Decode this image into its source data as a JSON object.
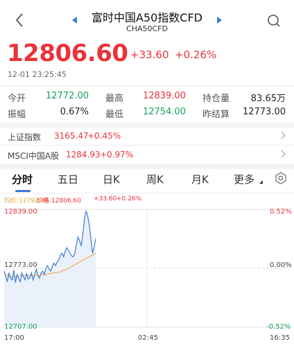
{
  "header": {
    "title": "富时中国A50指数CFD",
    "subtitle": "CHA50CFD"
  },
  "quote": {
    "price": "12806.60",
    "change": "+33.60",
    "change_pct": "+0.26%",
    "timestamp": "12-01 23:25:45"
  },
  "stats": {
    "open_label": "今开",
    "open": "12772.00",
    "high_label": "最高",
    "high": "12839.00",
    "oi_label": "持仓量",
    "oi": "83.65万",
    "amp_label": "振幅",
    "amp": "0.67%",
    "low_label": "最低",
    "low": "12754.00",
    "prev_label": "昨结算",
    "prev": "12773.00"
  },
  "indices": [
    {
      "name": "上证指数",
      "value": "3165.47",
      "pct": "+0.45%"
    },
    {
      "name": "MSCI中国A股",
      "value": "1284.93",
      "pct": "+0.97%"
    }
  ],
  "tabs": [
    "分时",
    "五日",
    "日K",
    "周K",
    "月K",
    "更多"
  ],
  "legend": {
    "avg": "均价:12792.48",
    "price": "价格:12806.60",
    "chg": "+33.60",
    "pct": "+0.26%"
  },
  "colors": {
    "up": "#e8333b",
    "down": "#17a35a",
    "line": "#3a7bd5",
    "avg": "#e8a033",
    "fill": "#eaf1fb"
  },
  "chart_data": {
    "type": "line",
    "y_left": {
      "top": "12839.00",
      "mid": "12773.00",
      "bottom": "12707.00"
    },
    "y_right": {
      "top": "0.52%",
      "mid": "0.00%",
      "bottom": "-0.52%"
    },
    "x_labels": [
      "17:00",
      "02:45",
      "16:35"
    ],
    "ylim": [
      12707,
      12839
    ],
    "prev_close": 12773,
    "series": [
      {
        "values": [
          12770,
          12764,
          12758,
          12768,
          12762,
          12760,
          12771,
          12757,
          12766,
          12762,
          12758,
          12768,
          12764,
          12760,
          12767,
          12761,
          12763,
          12768,
          12760,
          12766,
          12772,
          12765,
          12762,
          12768,
          12770,
          12766,
          12773,
          12776,
          12772,
          12770,
          12775,
          12779,
          12776,
          12780,
          12782,
          12788,
          12790,
          12786,
          12792,
          12796,
          12793,
          12790,
          12787,
          12786,
          12790,
          12800,
          12808,
          12804,
          12798,
          12812,
          12828,
          12837,
          12832,
          12822,
          12806,
          12790,
          12797,
          12806
        ]
      },
      {
        "values": [
          12768,
          12766,
          12765,
          12764,
          12763,
          12763,
          12764,
          12764,
          12764,
          12764,
          12765,
          12765,
          12765,
          12765,
          12765,
          12765,
          12765,
          12765,
          12765,
          12765,
          12765,
          12765,
          12765,
          12766,
          12766,
          12766,
          12766,
          12766,
          12767,
          12767,
          12768,
          12768,
          12768,
          12768,
          12769,
          12769,
          12770,
          12771,
          12771,
          12772,
          12773,
          12774,
          12775,
          12776,
          12777,
          12778,
          12779,
          12780,
          12781,
          12782,
          12783,
          12784,
          12785,
          12786,
          12787,
          12788,
          12789,
          12790
        ]
      }
    ]
  }
}
